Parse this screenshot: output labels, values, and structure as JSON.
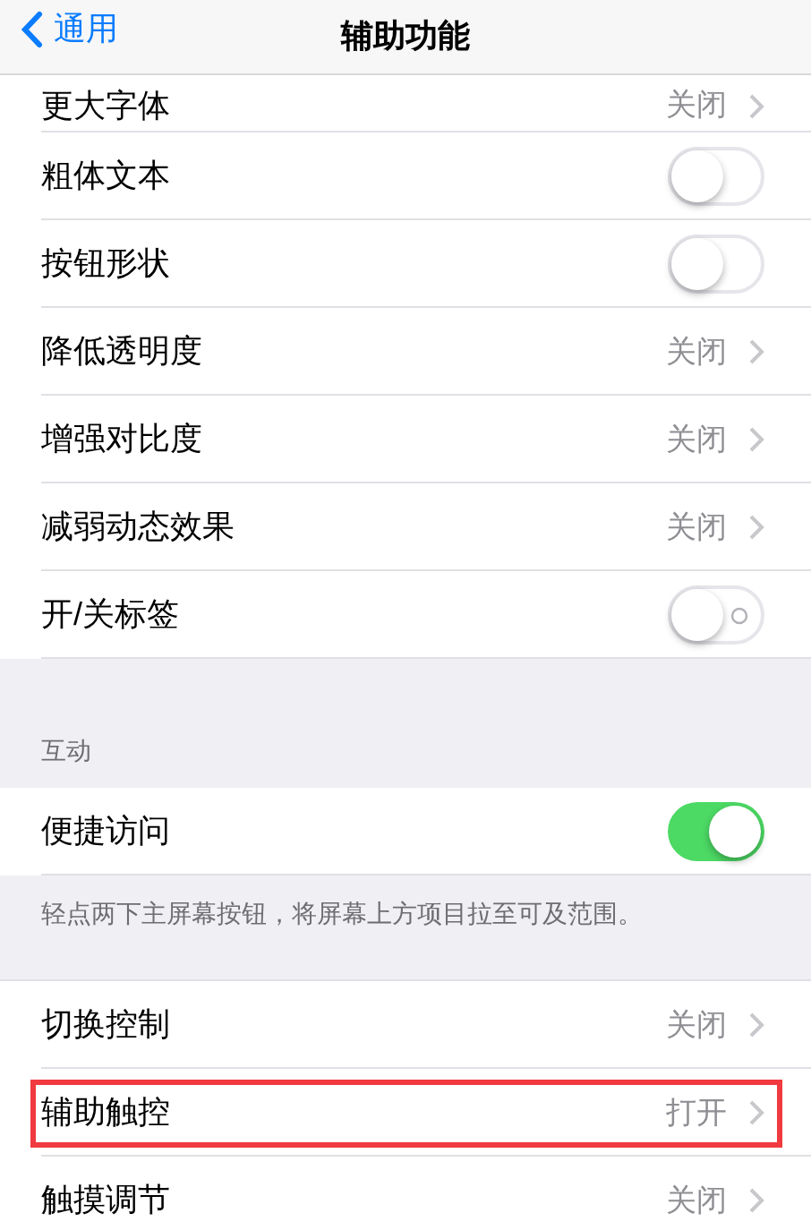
{
  "nav": {
    "back_label": "通用",
    "title": "辅助功能"
  },
  "sections": [
    {
      "rows": [
        {
          "kind": "link",
          "label": "更大字体",
          "value": "关闭",
          "highlighted": false
        },
        {
          "kind": "toggle",
          "label": "粗体文本",
          "on": false,
          "onoff_labels": false,
          "highlighted": false
        },
        {
          "kind": "toggle",
          "label": "按钮形状",
          "on": false,
          "onoff_labels": false,
          "highlighted": false
        },
        {
          "kind": "link",
          "label": "降低透明度",
          "value": "关闭",
          "highlighted": false
        },
        {
          "kind": "link",
          "label": "增强对比度",
          "value": "关闭",
          "highlighted": false
        },
        {
          "kind": "link",
          "label": "减弱动态效果",
          "value": "关闭",
          "highlighted": false
        },
        {
          "kind": "toggle",
          "label": "开/关标签",
          "on": false,
          "onoff_labels": true,
          "highlighted": false
        }
      ]
    },
    {
      "header": "互动",
      "footer": "轻点两下主屏幕按钮，将屏幕上方项目拉至可及范围。",
      "rows": [
        {
          "kind": "toggle",
          "label": "便捷访问",
          "on": true,
          "onoff_labels": false,
          "highlighted": false
        }
      ]
    },
    {
      "rows": [
        {
          "kind": "link",
          "label": "切换控制",
          "value": "关闭",
          "highlighted": false
        },
        {
          "kind": "link",
          "label": "辅助触控",
          "value": "打开",
          "highlighted": true
        },
        {
          "kind": "link",
          "label": "触摸调节",
          "value": "关闭",
          "highlighted": false
        }
      ]
    }
  ]
}
